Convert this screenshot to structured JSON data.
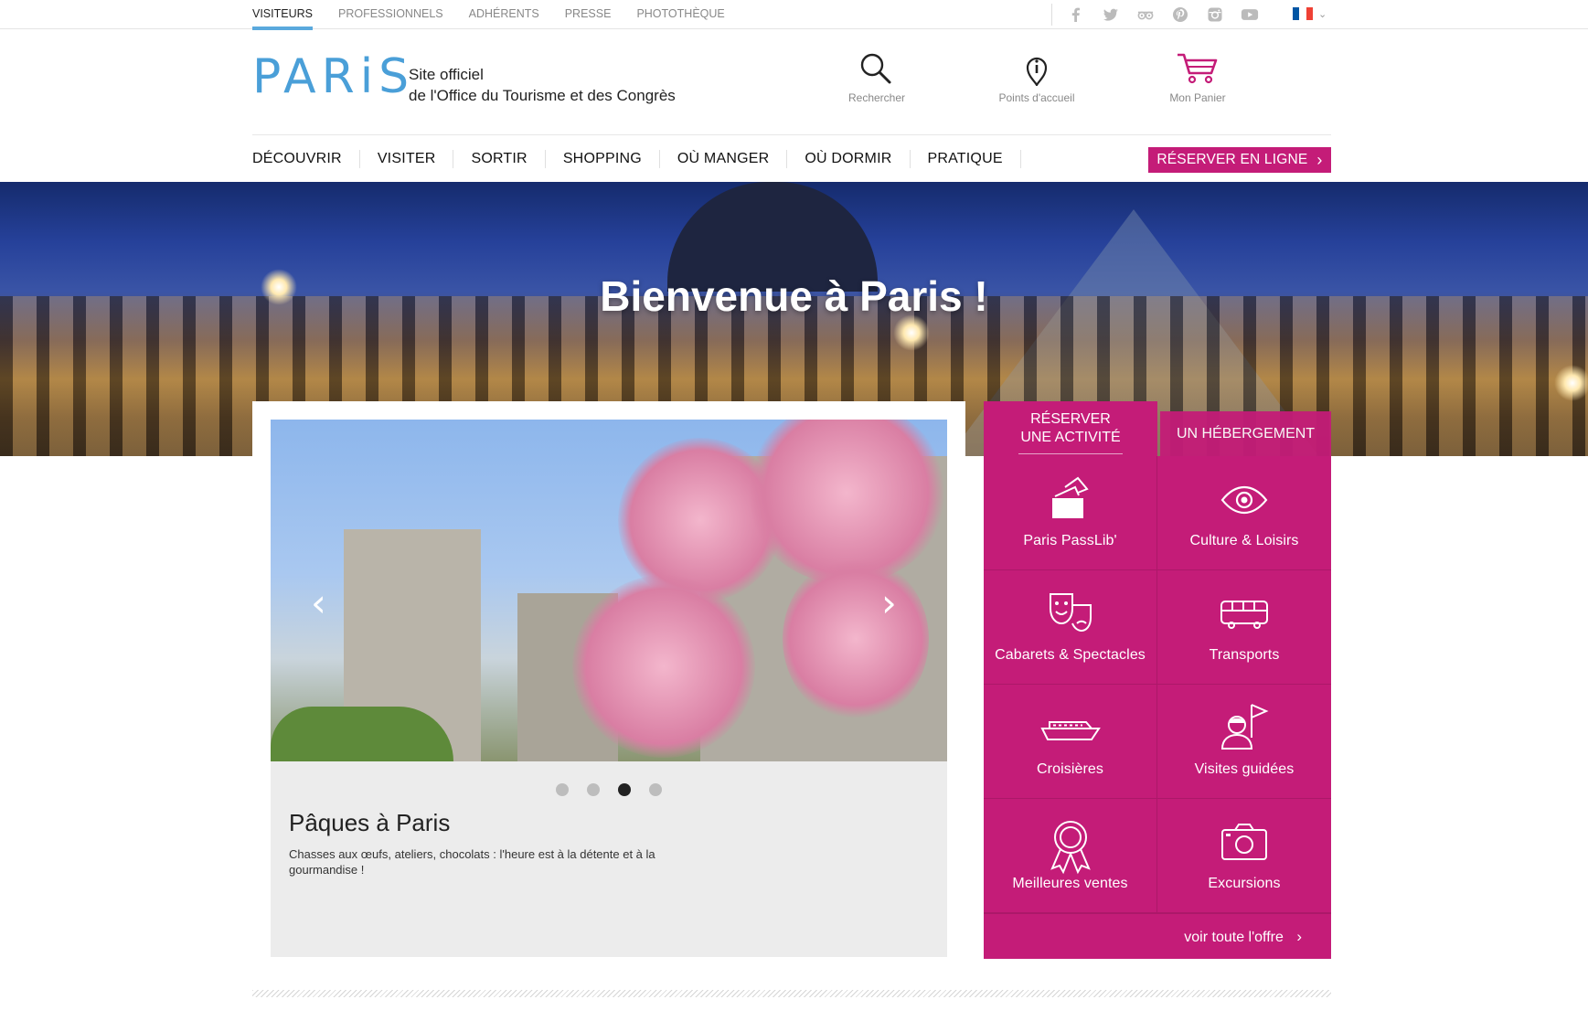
{
  "top_nav": [
    "VISITEURS",
    "PROFESSIONNELS",
    "ADHÉRENTS",
    "PRESSE",
    "PHOTOTHÈQUE"
  ],
  "social_icons": [
    "facebook-icon",
    "twitter-icon",
    "tripadvisor-icon",
    "pinterest-icon",
    "instagram-icon",
    "youtube-icon"
  ],
  "language": {
    "flag": "france-flag-icon",
    "colors": [
      "#0055a4",
      "#ffffff",
      "#ef4135"
    ]
  },
  "header": {
    "logo": "PARiS",
    "tagline_line1": "Site officiel",
    "tagline_line2": "de l'Office du Tourisme et des Congrès",
    "search_label": "Rechercher",
    "welcome_points_label": "Points d'accueil",
    "cart_label": "Mon Panier"
  },
  "main_nav": [
    "DÉCOUVRIR",
    "VISITER",
    "SORTIR",
    "SHOPPING",
    "OÙ MANGER",
    "OÙ DORMIR",
    "PRATIQUE"
  ],
  "book_online_label": "RÉSERVER EN LIGNE",
  "hero": {
    "title": "Bienvenue à Paris !"
  },
  "carousel": {
    "slide_title": "Pâques à Paris",
    "slide_text": "Chasses aux œufs, ateliers, chocolats : l'heure est à la détente et à la gourmandise !",
    "dots_count": 4,
    "active_dot": 3
  },
  "booking": {
    "tab_activity_line1": "RÉSERVER",
    "tab_activity_line2": "UNE ACTIVITÉ",
    "tab_hotel": "UN HÉBERGEMENT",
    "items": [
      {
        "label": "Paris PassLib'",
        "icon": "ticket-icon"
      },
      {
        "label": "Culture & Loisirs",
        "icon": "eye-icon"
      },
      {
        "label": "Cabarets & Spectacles",
        "icon": "theater-masks-icon"
      },
      {
        "label": "Transports",
        "icon": "bus-icon"
      },
      {
        "label": "Croisières",
        "icon": "boat-icon"
      },
      {
        "label": "Visites guidées",
        "icon": "guide-flag-icon"
      },
      {
        "label": "Meilleures ventes",
        "icon": "award-ribbon-icon"
      },
      {
        "label": "Excursions",
        "icon": "camera-icon"
      }
    ],
    "see_all_label": "voir toute l'offre"
  },
  "colors": {
    "accent": "#c41c78",
    "logo_blue": "#4a9fd8"
  }
}
